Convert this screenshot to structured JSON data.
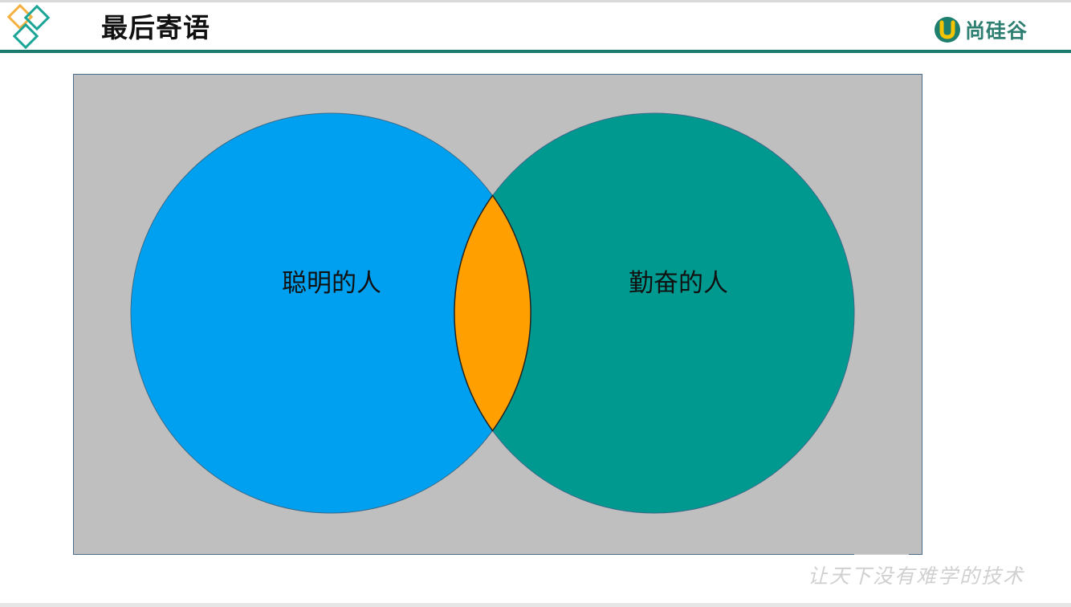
{
  "header": {
    "title": "最后寄语",
    "brand_name": "尚硅谷",
    "logo_icon": "diamond-squares-logo-icon",
    "brand_icon": "u-brand-icon"
  },
  "venn": {
    "left_label": "聪明的人",
    "right_label": "勤奋的人"
  },
  "footer": {
    "slogan": "让天下没有难学的技术"
  },
  "colors": {
    "accent": "#1b7a6d",
    "left_circle": "#00a0f0",
    "right_circle": "#009990",
    "intersection": "#ffa000",
    "canvas": "#bfbfbf",
    "logo_orange": "#f5b042",
    "logo_teal": "#1aa596"
  }
}
